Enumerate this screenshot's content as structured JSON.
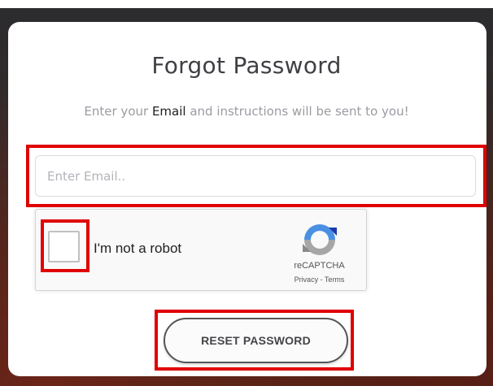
{
  "form": {
    "title": "Forgot Password",
    "subtitle_before": "Enter your ",
    "subtitle_bold": "Email",
    "subtitle_after": " and instructions will be sent to you!",
    "email_placeholder": "Enter Email..",
    "email_value": ""
  },
  "captcha": {
    "label": "I'm not a robot",
    "brand": "reCAPTCHA",
    "privacy": "Privacy",
    "separator": " - ",
    "terms": "Terms",
    "checked": false,
    "icon": "recaptcha-logo-icon"
  },
  "actions": {
    "reset_label": "RESET PASSWORD"
  },
  "colors": {
    "highlight": "#e00000",
    "button_border": "#555558"
  }
}
